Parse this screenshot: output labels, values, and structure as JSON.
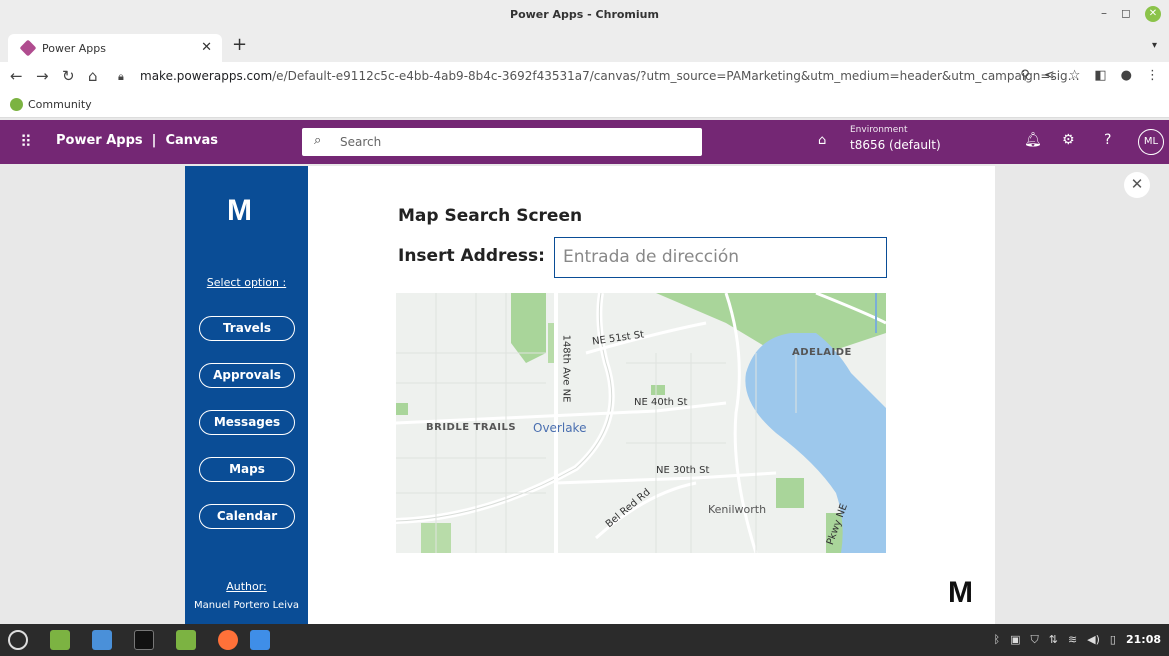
{
  "window": {
    "title": "Power Apps - Chromium"
  },
  "tab": {
    "label": "Power Apps"
  },
  "address_bar": {
    "host": "make.powerapps.com",
    "path": "/e/Default-e9112c5c-e4bb-4ab9-8b4c-3692f43531a7/canvas/?utm_source=PAMarketing&utm_medium=header&utm_campaign=sig…"
  },
  "bookmarks": [
    {
      "label": "Community"
    }
  ],
  "header": {
    "app_name": "Power Apps  |  Canvas",
    "search_placeholder": "Search",
    "environment_label": "Environment",
    "environment_value": "t8656 (default)",
    "avatar_initials": "ML"
  },
  "sidebar": {
    "logo": "M",
    "select_label": "Select option :",
    "items": [
      {
        "label": "Travels"
      },
      {
        "label": "Approvals"
      },
      {
        "label": "Messages"
      },
      {
        "label": "Maps"
      },
      {
        "label": "Calendar"
      }
    ],
    "author_label": "Author:",
    "author_name": "Manuel Portero Leiva"
  },
  "screen": {
    "title": "Map Search Screen",
    "address_label": "Insert Address:",
    "address_placeholder": "Entrada de dirección",
    "corner_logo": "M"
  },
  "map": {
    "labels": {
      "road1": "NE 51st St",
      "road2": "148th Ave NE",
      "road3": "NE 40th St",
      "road4": "NE 30th St",
      "road5": "Bel Red Rd",
      "road6": "Pkwy NE",
      "area1": "ADELAIDE",
      "area2": "BRIDLE TRAILS",
      "city1": "Overlake",
      "city2": "Kenilworth"
    },
    "colors": {
      "water": "#9dc8ec",
      "park": "#a9d59a",
      "land": "#eef1ee"
    }
  },
  "taskbar": {
    "clock": "21:08"
  }
}
